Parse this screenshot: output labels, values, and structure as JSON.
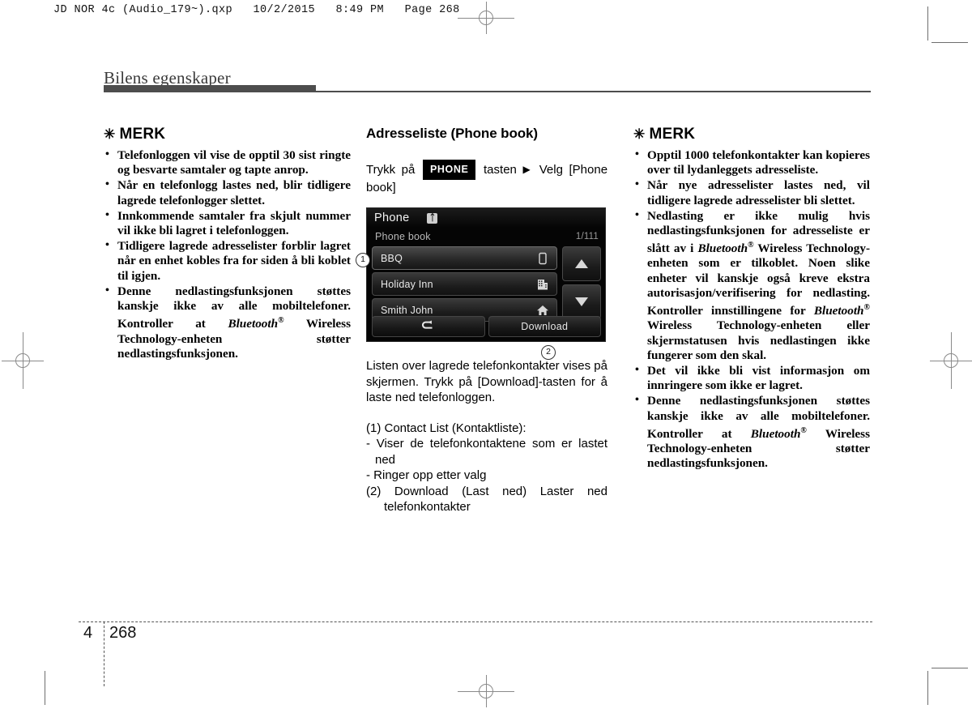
{
  "print_slug": "JD NOR 4c (Audio_179~).qxp   10/2/2015   8:49 PM   Page 268",
  "running_head": "Bilens egenskaper",
  "left_note": {
    "title_symbol": "✳",
    "title": "MERK",
    "items": [
      "Telefonloggen vil vise de opptil 30 sist ringte og besvarte samtaler og tapte anrop.",
      "Når en telefonlogg lastes ned, blir tidligere lagrede telefonlogger slettet.",
      "Innkommende samtaler fra skjult nummer vil ikke bli lagret i telefonloggen.",
      "Tidligere lagrede adresselister forblir lagret når en enhet kobles fra for siden å bli koblet til igjen."
    ],
    "last_item": {
      "before": "Denne nedlastingsfunksjonen støttes kanskje ikke av alle mobiltelefoner. Kontroller at ",
      "trademark": "Bluetooth",
      "registered": "®",
      "after": " Wireless Technology-enheten støtter nedlastingsfunksjonen."
    }
  },
  "middle": {
    "section_title": "Adresseliste (Phone book)",
    "instruction_prefix": "Trykk på",
    "key_label": "PHONE",
    "instruction_mid": "tasten",
    "arrow": "▶",
    "instruction_suffix": "Velg [Phone book]",
    "screen": {
      "title": "Phone",
      "bluetooth_icon": "bluetooth-icon",
      "subtitle": "Phone book",
      "counter": "1/111",
      "rows": [
        {
          "label": "BBQ",
          "icon": "mobile-phone-icon",
          "selected": true
        },
        {
          "label": "Holiday Inn",
          "icon": "office-building-icon",
          "selected": false
        },
        {
          "label": "Smith John",
          "icon": "home-icon",
          "selected": false
        }
      ],
      "scroll_up": "scroll-up-icon",
      "scroll_down": "scroll-down-icon",
      "back_button": "↶",
      "download_button": "Download",
      "callout_1": "①",
      "callout_2": "②"
    },
    "paragraph": "Listen over lagrede telefonkontakter vises på skjermen. Trykk på [Download]-tasten for å laste ned telefonloggen.",
    "legend": [
      "(1) Contact List (Kontaktliste):",
      "- Viser de telefonkontaktene som er lastet ned",
      "- Ringer opp etter valg",
      "(2) Download (Last ned) Laster ned telefonkontakter"
    ]
  },
  "right_note": {
    "title_symbol": "✳",
    "title": "MERK",
    "items": [
      "Opptil 1000 telefonkontakter kan kopieres over til lydanleggets adresseliste.",
      "Når nye adresselister lastes ned, vil tidligere lagrede adresselister bli slettet."
    ],
    "item_bt_1": {
      "p1": "Nedlasting er ikke mulig hvis nedlastingsfunksjonen for adresseliste er slått av i ",
      "bt1": "Bluetooth",
      "reg1": "®",
      "p2": " Wireless Technology-enheten som er tilkoblet. Noen slike enheter vil kanskje også kreve ekstra autorisasjon/verifisering for nedlasting. Kontroller innstillingene for ",
      "bt2": "Bluetooth",
      "reg2": "®",
      "p3": " Wireless Technology-enheten eller skjermstatusen hvis nedlastingen ikke fungerer som den skal."
    },
    "item_plain": "Det vil ikke bli vist informasjon om innringere som ikke er lagret.",
    "item_bt_2": {
      "p1": "Denne nedlastingsfunksjonen støttes kanskje ikke av alle mobiltelefoner. Kontroller at ",
      "bt1": "Bluetooth",
      "reg1": "®",
      "p2": " Wireless Technology-enheten støtter nedlastingsfunksjonen."
    }
  },
  "footer": {
    "chapter": "4",
    "page": "268"
  },
  "colors": {
    "rule": "#4d4d4d",
    "screen_bg": "#050505",
    "key_chip_bg": "#000000"
  }
}
